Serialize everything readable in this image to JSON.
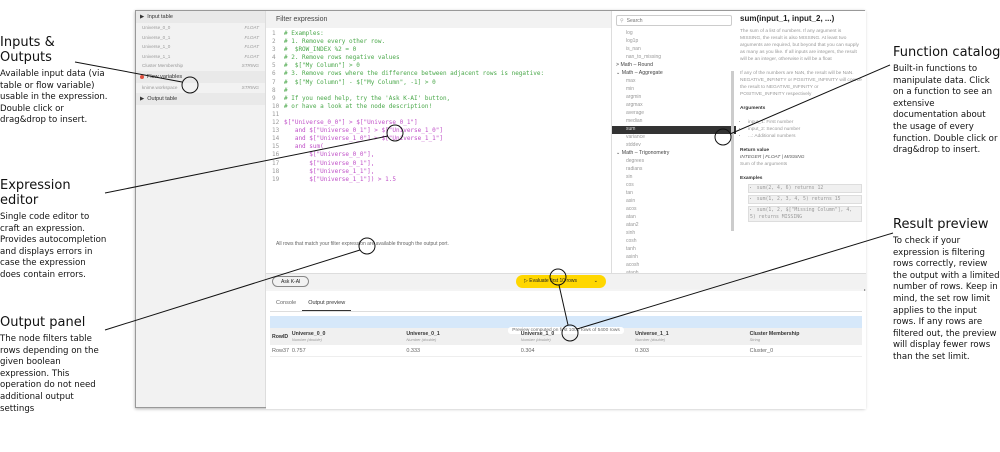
{
  "annotations": [
    {
      "title": "Inputs & Outputs",
      "text": "Available input data (via table or flow variable) usable in the expression. Double click or drag&drop to insert."
    },
    {
      "title": "Expression editor",
      "text": "Single code editor to craft an expression. Provides autocompletion and displays errors in case the expression does contain errors."
    },
    {
      "title": "Output panel",
      "text": "The node filters table rows depending on the given boolean expression. This operation do not need additional output settings"
    },
    {
      "title": "Function catalog",
      "text": "Built-in functions to manipulate data. Click on a function to see an extensive documentation about the usage of every function. Double click or drag&drop to insert."
    },
    {
      "title": "Result preview",
      "text": "To check if your expression is filtering rows correctly, review the output with a limited number of rows. Keep in mind, the set row limit applies to the input rows. If any rows are filtered out, the preview will display fewer rows than the set limit."
    }
  ],
  "left": {
    "input_table": "Input table",
    "columns": [
      {
        "name": "Universe_0_0",
        "type": "FLOAT"
      },
      {
        "name": "Universe_0_1",
        "type": "FLOAT"
      },
      {
        "name": "Universe_1_0",
        "type": "FLOAT"
      },
      {
        "name": "Universe_1_1",
        "type": "FLOAT"
      },
      {
        "name": "Cluster Membership",
        "type": "STRING"
      }
    ],
    "flow_variables": "Flow variables",
    "flow": [
      {
        "name": "knime.workspace",
        "type": "STRING"
      }
    ],
    "output_table": "Output table"
  },
  "editor": {
    "title": "Filter expression",
    "lines": [
      "# Examples:",
      "# 1. Remove every other row.",
      "#  $ROW_INDEX %2 = 0",
      "# 2. Remove rows negative values",
      "#  $[\"My Column\"] > 0",
      "# 3. Remove rows where the difference between adjacent rows is negative:",
      "#  $[\"My Column\"] - $[\"My Column\", -1] > 0",
      "#",
      "# If you need help, try the 'Ask K-AI' button,",
      "# or have a look at the node description!",
      "",
      "$[\"Universe_0_0\"] > $[\"Universe_0_1\"]",
      "   and $[\"Universe_0_1\"] > $[\"Universe_1_0\"]",
      "   and $[\"Universe_1_0\"] > $[\"Universe_1_1\"]",
      "   and sum(",
      "       $[\"Universe_0_0\"],",
      "       $[\"Universe_0_1\"],",
      "       $[\"Universe_1_1\"],",
      "       $[\"Universe_1_1\"]) > 1.5"
    ],
    "hint": "All rows that match your filter expression are available through the output port.",
    "ask_ai": "Ask K-AI",
    "evaluate": "Evaluate first 10 rows"
  },
  "catalog": {
    "search_placeholder": "Search",
    "items": [
      {
        "t": "f",
        "l": "log"
      },
      {
        "t": "f",
        "l": "log1p"
      },
      {
        "t": "f",
        "l": "is_nan"
      },
      {
        "t": "f",
        "l": "nan_to_missing"
      },
      {
        "t": "c",
        "l": "> Math – Round"
      },
      {
        "t": "c",
        "l": "⌄ Math – Aggregate"
      },
      {
        "t": "f",
        "l": "max"
      },
      {
        "t": "f",
        "l": "min"
      },
      {
        "t": "f",
        "l": "argmin"
      },
      {
        "t": "f",
        "l": "argmax"
      },
      {
        "t": "f",
        "l": "average"
      },
      {
        "t": "f",
        "l": "median"
      },
      {
        "t": "s",
        "l": "sum"
      },
      {
        "t": "f",
        "l": "variance"
      },
      {
        "t": "f",
        "l": "stddev"
      },
      {
        "t": "c",
        "l": "⌄ Math – Trigonometry"
      },
      {
        "t": "f",
        "l": "degrees"
      },
      {
        "t": "f",
        "l": "radians"
      },
      {
        "t": "f",
        "l": "sin"
      },
      {
        "t": "f",
        "l": "cos"
      },
      {
        "t": "f",
        "l": "tan"
      },
      {
        "t": "f",
        "l": "asin"
      },
      {
        "t": "f",
        "l": "acos"
      },
      {
        "t": "f",
        "l": "atan"
      },
      {
        "t": "f",
        "l": "atan2"
      },
      {
        "t": "f",
        "l": "sinh"
      },
      {
        "t": "f",
        "l": "cosh"
      },
      {
        "t": "f",
        "l": "tanh"
      },
      {
        "t": "f",
        "l": "asinh"
      },
      {
        "t": "f",
        "l": "acosh"
      },
      {
        "t": "f",
        "l": "atanh"
      },
      {
        "t": "c",
        "l": "> Math – Distributions"
      }
    ]
  },
  "doc": {
    "title": "sum(input_1, input_2, ...)",
    "p1": "The sum of a list of numbers. If any argument is MISSING, the result is also MISSING. At least two arguments are required, but beyond that you can supply as many as you like. If all inputs are integers, the result will be an integer, otherwise it will be a float",
    "p2": "If any of the numbers are NaN, the result will be NaN. NEGATIVE_INFINITY or POSITIVE_INFINITY will coerce the result to NEGATIVE_INFINITY or POSITIVE_INFINITY respectively",
    "arguments": "Arguments",
    "args": [
      "input_1: First number",
      "input_2: Second number",
      "...: Additional numbers"
    ],
    "return_value": "Return value",
    "return_type": "INTEGER | FLOAT | MISSING",
    "return_desc": "Sum of the arguments",
    "examples": "Examples",
    "ex": [
      "sum(2, 4, 6) returns 12",
      "sum(1, 2, 3, 4, 5) returns 15",
      "sum(1, 2, $[\"Missing Column\"], 4, 5) returns MISSING"
    ]
  },
  "bottom": {
    "tabs": [
      "Console",
      "Output preview"
    ],
    "active_tab": "Output preview",
    "banner": "Preview computed on first 1000 rows of 5400 rows",
    "rowid": "RowID",
    "headers": [
      {
        "n": "Universe_0_0",
        "t": "Number (double)"
      },
      {
        "n": "Universe_0_1",
        "t": "Number (double)"
      },
      {
        "n": "Universe_1_0",
        "t": "Number (double)"
      },
      {
        "n": "Universe_1_1",
        "t": "Number (double)"
      },
      {
        "n": "Cluster Membership",
        "t": "String"
      }
    ],
    "rows": [
      [
        "Row37",
        "0.757",
        "0.333",
        "0.304",
        "0.303",
        "Cluster_0"
      ]
    ]
  },
  "colors": {
    "accent": "#ffd700",
    "comment": "#4aa84a",
    "string": "#c050c8",
    "banner": "#d6e8fa"
  }
}
